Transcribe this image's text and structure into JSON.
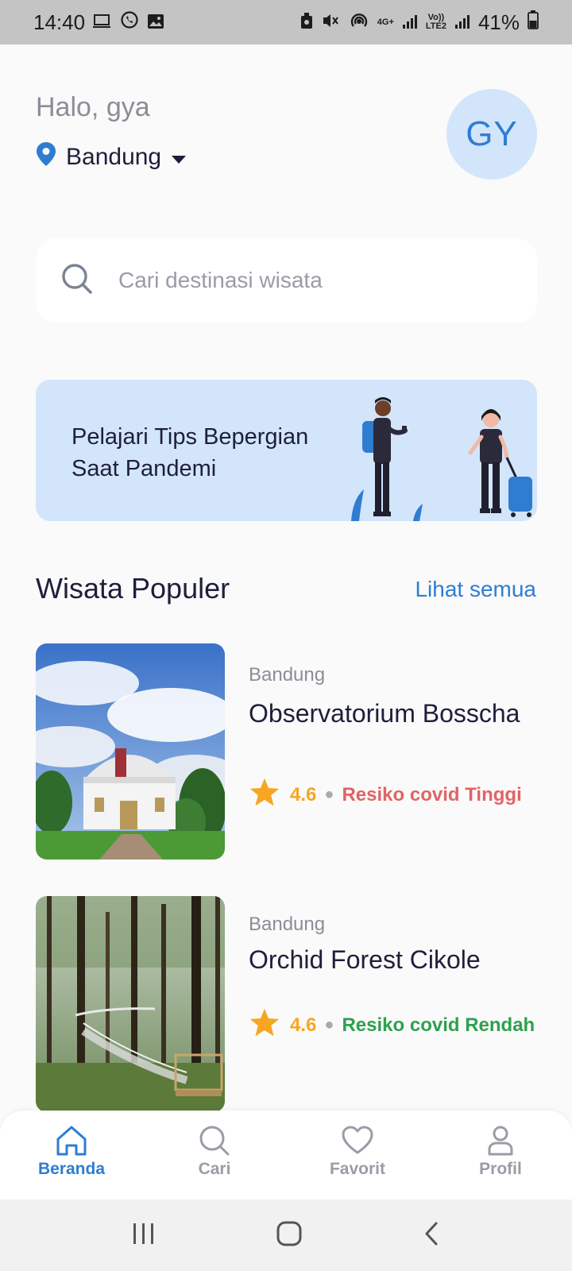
{
  "status_bar": {
    "time": "14:40",
    "network": "4G+",
    "volte": "Vo))",
    "lte": "LTE2",
    "battery": "41%"
  },
  "header": {
    "greeting": "Halo, gya",
    "location": "Bandung",
    "avatar_initials": "GY"
  },
  "search": {
    "placeholder": "Cari destinasi wisata"
  },
  "banner": {
    "text": "Pelajari Tips Bepergian Saat Pandemi"
  },
  "popular": {
    "title": "Wisata Populer",
    "see_all": "Lihat semua",
    "items": [
      {
        "city": "Bandung",
        "name": "Observatorium Bosscha",
        "rating": "4.6",
        "risk": "Resiko covid Tinggi",
        "risk_color": "#e06466"
      },
      {
        "city": "Bandung",
        "name": "Orchid Forest Cikole",
        "rating": "4.6",
        "risk": "Resiko covid Rendah",
        "risk_color": "#2ea04f"
      }
    ]
  },
  "bottom_nav": {
    "items": [
      {
        "label": "Beranda",
        "icon": "home-icon",
        "active": true
      },
      {
        "label": "Cari",
        "icon": "search-icon",
        "active": false
      },
      {
        "label": "Favorit",
        "icon": "heart-icon",
        "active": false
      },
      {
        "label": "Profil",
        "icon": "user-icon",
        "active": false
      }
    ]
  },
  "colors": {
    "accent": "#2f7dd1",
    "star": "#f6a623",
    "banner_bg": "#d3e5fb"
  }
}
